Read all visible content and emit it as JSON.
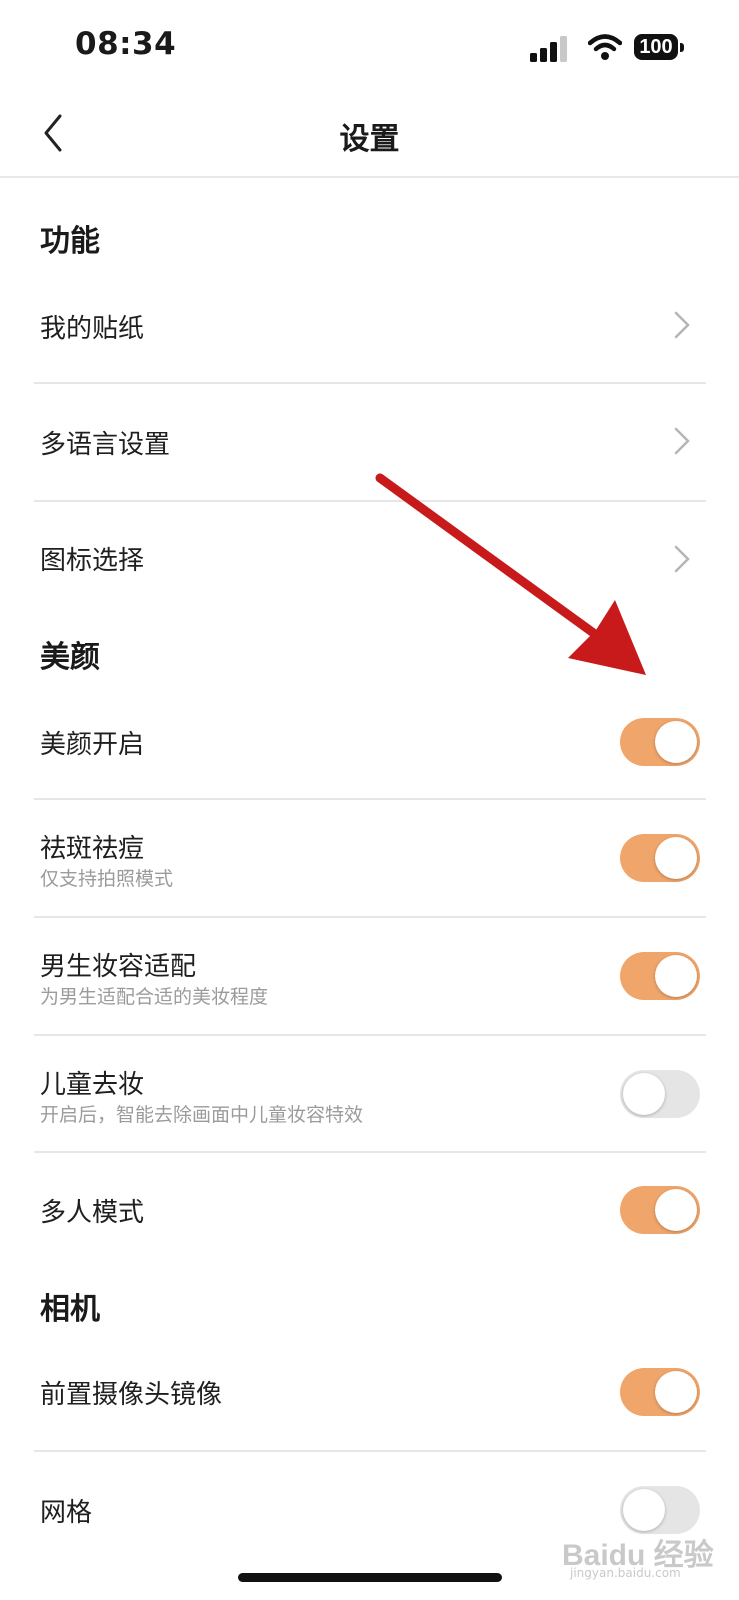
{
  "status_bar": {
    "time": "08:34",
    "battery": "100",
    "icons": [
      "signal-icon",
      "wifi-icon",
      "battery-icon"
    ]
  },
  "nav": {
    "title": "设置",
    "back_icon": "chevron-left-icon"
  },
  "sections": {
    "features": "功能",
    "beauty": "美颜",
    "camera": "相机"
  },
  "rows": {
    "stickers": "我的贴纸",
    "language": "多语言设置",
    "icon_select": "图标选择",
    "beauty_on": {
      "label": "美颜开启",
      "on": true
    },
    "blemish": {
      "label": "祛斑祛痘",
      "sub": "仅支持拍照模式",
      "on": true
    },
    "male_makeup": {
      "label": "男生妆容适配",
      "sub": "为男生适配合适的美妆程度",
      "on": true
    },
    "child_makeup": {
      "label": "儿童去妆",
      "sub": "开启后，智能去除画面中儿童妆容特效",
      "on": false
    },
    "multi_person": {
      "label": "多人模式",
      "on": true
    },
    "front_mirror": {
      "label": "前置摄像头镜像",
      "on": true
    },
    "grid": {
      "label": "网格",
      "on": false
    }
  },
  "colors": {
    "toggle_on": "#f0a56a",
    "toggle_off": "#e5e5e5",
    "arrow": "#c8191b"
  },
  "watermark": {
    "main": "Baidu 经验",
    "sub": "jingyan.baidu.com"
  }
}
